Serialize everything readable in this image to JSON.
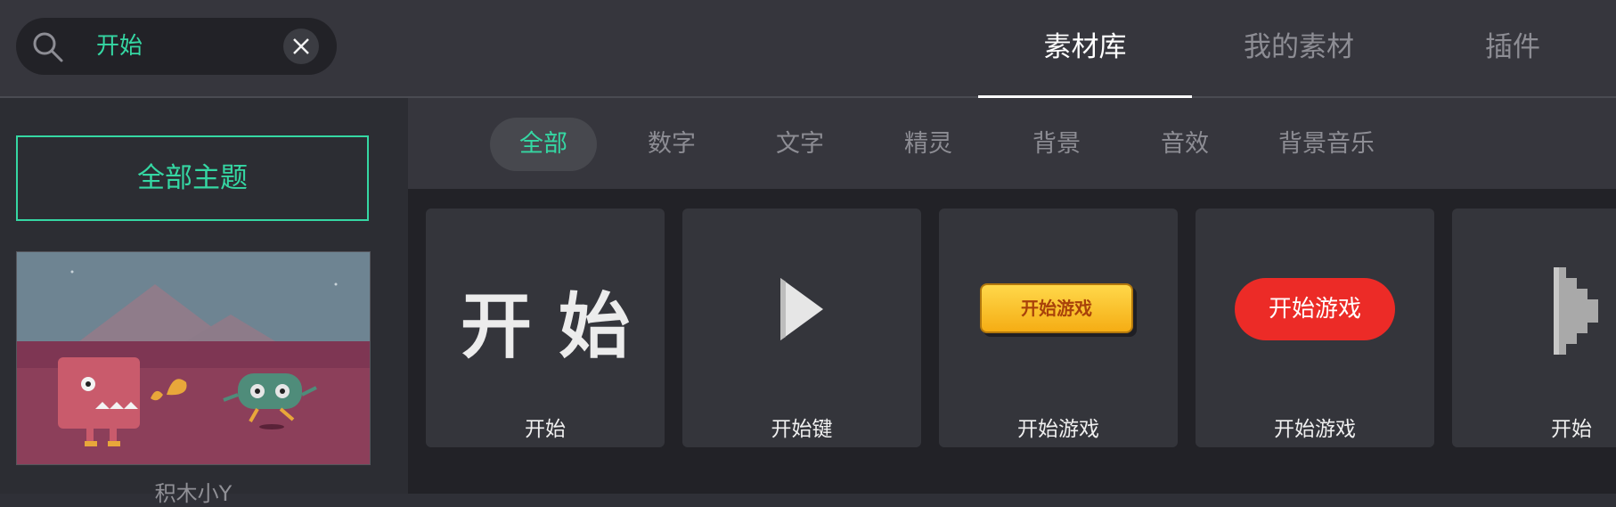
{
  "search": {
    "query": "开始",
    "search_icon": "search-icon",
    "clear_icon": "close-icon"
  },
  "tabs": [
    {
      "label": "素材库",
      "active": true
    },
    {
      "label": "我的素材",
      "active": false
    },
    {
      "label": "插件",
      "active": false
    }
  ],
  "sidebar": {
    "all_topics": "全部主题",
    "theme_label": "积木小Y"
  },
  "filters": [
    {
      "label": "全部",
      "active": true
    },
    {
      "label": "数字",
      "active": false
    },
    {
      "label": "文字",
      "active": false
    },
    {
      "label": "精灵",
      "active": false
    },
    {
      "label": "背景",
      "active": false
    },
    {
      "label": "音效",
      "active": false
    },
    {
      "label": "背景音乐",
      "active": false
    }
  ],
  "assets": [
    {
      "label": "开始",
      "thumb_text": "开始"
    },
    {
      "label": "开始键",
      "thumb_icon": "play-icon"
    },
    {
      "label": "开始游戏",
      "thumb_text": "开始游戏"
    },
    {
      "label": "开始游戏",
      "thumb_text": "开始游戏"
    },
    {
      "label": "开始",
      "thumb_icon": "pixel-arrow-icon"
    }
  ],
  "colors": {
    "accent": "#35d7a3",
    "background": "#2f3037",
    "red_button": "#ec2b27",
    "yellow_button": "#ffc52e"
  }
}
